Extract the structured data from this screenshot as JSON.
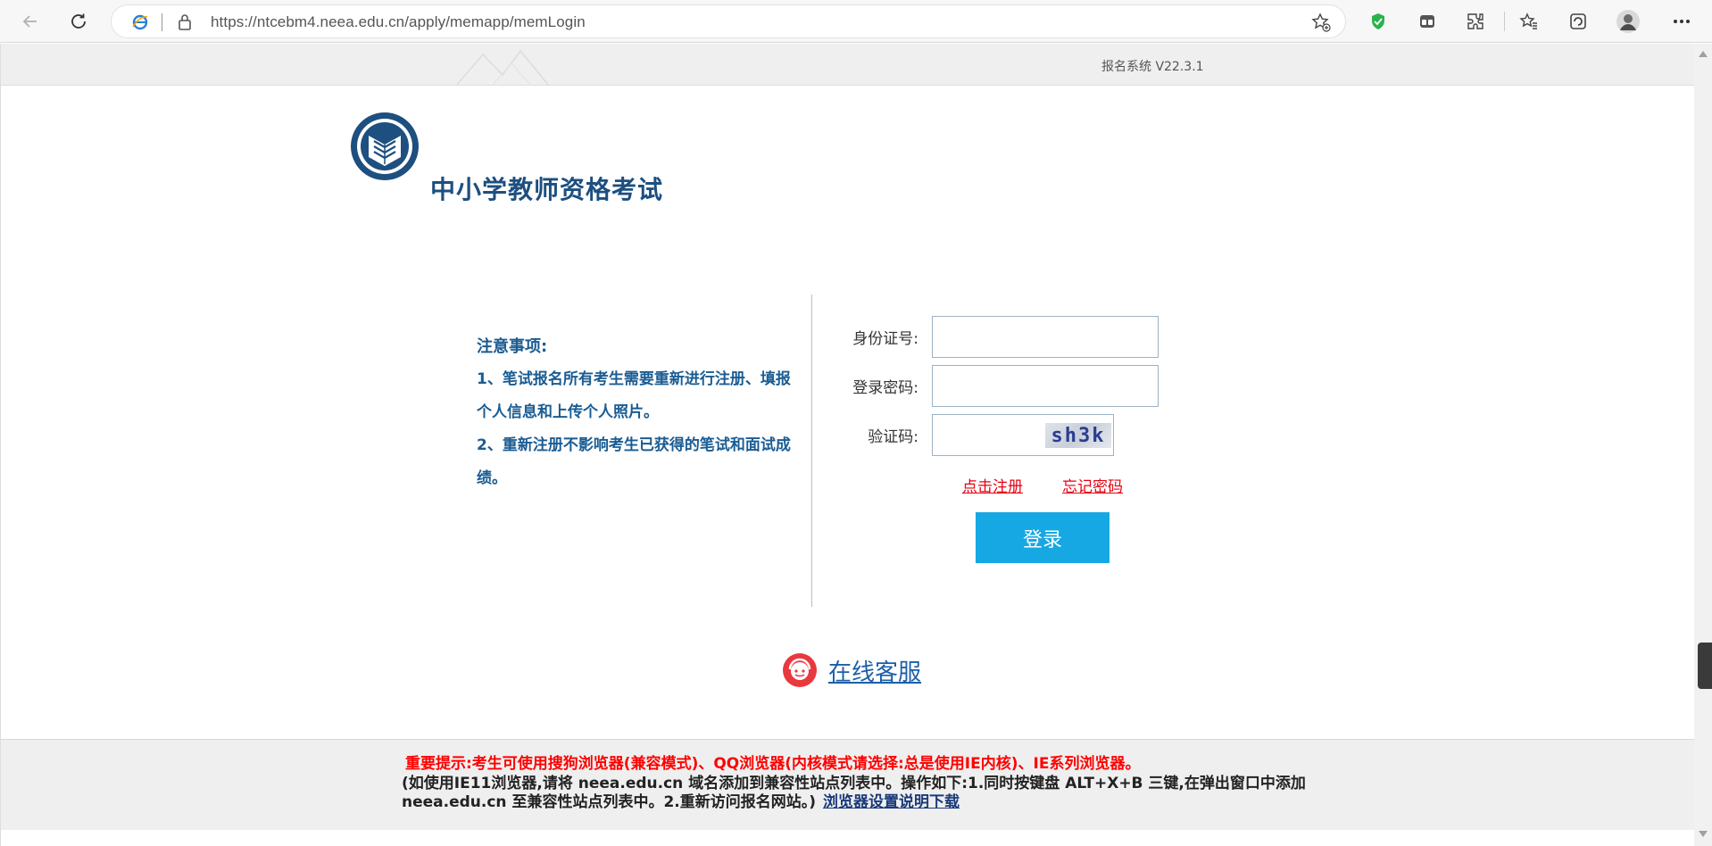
{
  "browser": {
    "url": "https://ntcebm4.neea.edu.cn/apply/memapp/memLogin"
  },
  "header": {
    "version": "报名系统 V22.3.1",
    "site_title": "中小学教师资格考试"
  },
  "notice": {
    "title": "注意事项:",
    "item1": "1、笔试报名所有考生需要重新进行注册、填报个人信息和上传个人照片。",
    "item2": "2、重新注册不影响考生已获得的笔试和面试成绩。"
  },
  "form": {
    "id_label": "身份证号:",
    "password_label": "登录密码:",
    "captcha_label": "验证码:",
    "captcha_text": "sh3k",
    "register_link": "点击注册",
    "forgot_link": "忘记密码",
    "login_button": "登录"
  },
  "service": {
    "label": "在线客服"
  },
  "footer": {
    "warning": "重要提示:考生可使用搜狗浏览器(兼容模式)、QQ浏览器(内核模式请选择:总是使用IE内核)、IE系列浏览器。",
    "info_line1": "(如使用IE11浏览器,请将 neea.edu.cn 域名添加到兼容性站点列表中。操作如下:1.同时按键盘 ALT+X+B 三键,在弹出窗口中添加",
    "info_line2": "neea.edu.cn 至兼容性站点列表中。2.重新访问报名网站。)",
    "download_link": "浏览器设置说明下载"
  },
  "colors": {
    "accent": "#16a8e3",
    "title_blue": "#1d4f80",
    "notice_blue": "#1a5c93",
    "link_red": "#e60012"
  }
}
